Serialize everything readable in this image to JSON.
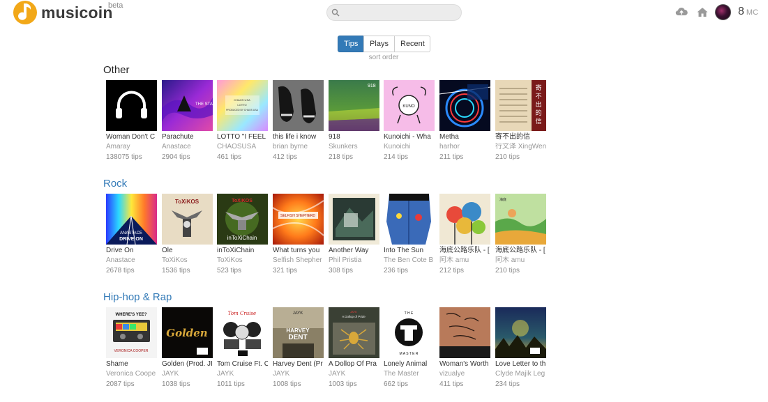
{
  "brand": {
    "name": "musicoin",
    "badge": "beta",
    "accent": "#f0a81d"
  },
  "search": {
    "placeholder": "",
    "value": ""
  },
  "header": {
    "balance": "8",
    "unit": "MC"
  },
  "sort": {
    "options": [
      "Tips",
      "Plays",
      "Recent"
    ],
    "active": "Tips",
    "caption": "sort order"
  },
  "sections": [
    {
      "title": "Other",
      "tracks": [
        {
          "title": "Woman Don't C",
          "artist": "Amaray",
          "tips": "138075 tips",
          "art": "headphones"
        },
        {
          "title": "Parachute",
          "artist": "Anastace",
          "tips": "2904 tips",
          "art": "purple"
        },
        {
          "title": "LOTTO \"I FEEL L",
          "artist": "CHAOSUSA",
          "tips": "461 tips",
          "art": "pastel"
        },
        {
          "title": "this life i know",
          "artist": "brian byrne",
          "tips": "412 tips",
          "art": "shoes"
        },
        {
          "title": "918",
          "artist": "Skunkers",
          "tips": "218 tips",
          "art": "green"
        },
        {
          "title": "Kunoichi - Wha",
          "artist": "Kunoichi",
          "tips": "214 tips",
          "art": "pink"
        },
        {
          "title": "Metha",
          "artist": "harhor",
          "tips": "211 tips",
          "art": "neon"
        },
        {
          "title": "寄不出的信",
          "artist": "行文泽 XingWen",
          "tips": "210 tips",
          "art": "letter"
        }
      ]
    },
    {
      "title": "Rock",
      "tracks": [
        {
          "title": "Drive On",
          "artist": "Anastace",
          "tips": "2678 tips",
          "art": "rainbow"
        },
        {
          "title": "Ole",
          "artist": "ToXiKos",
          "tips": "1536 tips",
          "art": "skull"
        },
        {
          "title": "inToXiChain",
          "artist": "ToXiKos",
          "tips": "523 tips",
          "art": "skullgreen"
        },
        {
          "title": "What turns you",
          "artist": "Selfish Shepher",
          "tips": "321 tips",
          "art": "orange"
        },
        {
          "title": "Another Way",
          "artist": "Phil Pristia",
          "tips": "308 tips",
          "art": "photo"
        },
        {
          "title": "Into The Sun",
          "artist": "The Ben Cote B",
          "tips": "236 tips",
          "art": "jeans"
        },
        {
          "title": "海底公路乐队 - [",
          "artist": "阿木 amu",
          "tips": "212 tips",
          "art": "trees"
        },
        {
          "title": "海底公路乐队 - [",
          "artist": "阿木 amu",
          "tips": "210 tips",
          "art": "greenart"
        }
      ]
    },
    {
      "title": "Hip-hop & Rap",
      "tracks": [
        {
          "title": "Shame",
          "artist": "Veronica Coope",
          "tips": "2087 tips",
          "art": "tape"
        },
        {
          "title": "Golden (Prod. JI",
          "artist": "JAYK",
          "tips": "1038 tips",
          "art": "golden"
        },
        {
          "title": "Tom Cruise Ft. C",
          "artist": "JAYK",
          "tips": "1011 tips",
          "art": "cartoon"
        },
        {
          "title": "Harvey Dent (Pr",
          "artist": "JAYK",
          "tips": "1008 tips",
          "art": "harvey"
        },
        {
          "title": "A Dollop Of Pra",
          "artist": "JAYK",
          "tips": "1003 tips",
          "art": "spider"
        },
        {
          "title": "Lonely Animal",
          "artist": "The Master",
          "tips": "662 tips",
          "art": "master"
        },
        {
          "title": "Woman's Worth",
          "artist": "vizualye",
          "tips": "411 tips",
          "art": "skin"
        },
        {
          "title": "Love Letter to th",
          "artist": "Clyde Majik Leg",
          "tips": "234 tips",
          "art": "night"
        }
      ]
    }
  ]
}
